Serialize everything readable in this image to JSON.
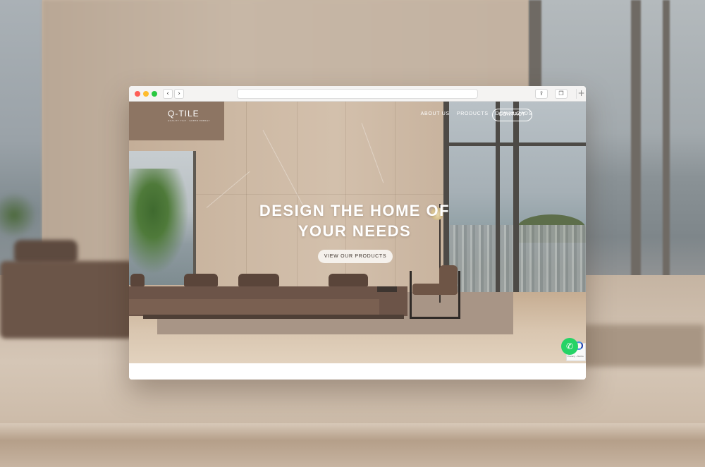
{
  "brand": {
    "logo": "Q-TILE",
    "tagline": "QUALITY TILE · GREEN ENERGY"
  },
  "nav": {
    "items": [
      {
        "label": "ABOUT US"
      },
      {
        "label": "PRODUCTS"
      },
      {
        "label": "DOWNLOADS"
      }
    ],
    "contact": "CONTACT"
  },
  "hero": {
    "title_line1": "DESIGN THE HOME OF",
    "title_line2": "YOUR NEEDS",
    "cta": "VIEW OUR PRODUCTS"
  },
  "widgets": {
    "whatsapp_icon": "whatsapp-icon",
    "recaptcha_text": "Privacy - Terms"
  },
  "colors": {
    "whatsapp": "#25d366",
    "browser_red": "#fe5f57",
    "browser_yellow": "#febc2e",
    "browser_green": "#28c840"
  }
}
